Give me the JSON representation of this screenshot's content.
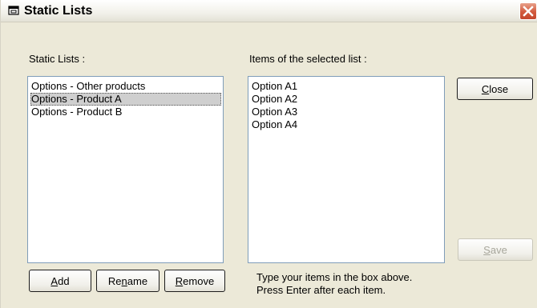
{
  "window": {
    "title": "Static Lists",
    "close_glyph": "✕"
  },
  "left_panel": {
    "label": "Static Lists :",
    "items": [
      {
        "label": "Options - Other products",
        "selected": false
      },
      {
        "label": "Options - Product A",
        "selected": true
      },
      {
        "label": "Options - Product B",
        "selected": false
      }
    ]
  },
  "right_panel": {
    "label": "Items of the selected list :",
    "items": [
      "Option A1",
      "Option A2",
      "Option A3",
      "Option A4"
    ],
    "hint_line1": "Type your items in the box above.",
    "hint_line2": "Press Enter after each item."
  },
  "buttons": {
    "add": {
      "pre": "",
      "mnemonic": "A",
      "post": "dd"
    },
    "rename": {
      "pre": "Re",
      "mnemonic": "n",
      "post": "ame"
    },
    "remove": {
      "pre": "",
      "mnemonic": "R",
      "post": "emove"
    },
    "close": {
      "pre": "",
      "mnemonic": "C",
      "post": "lose"
    },
    "save": {
      "pre": "",
      "mnemonic": "S",
      "post": "ave",
      "enabled": false
    }
  },
  "icons": {
    "title": "window-app-icon",
    "close": "close-icon"
  },
  "colors": {
    "dialog_bg": "#ece9d8",
    "close_button": "#d2593c",
    "selection": "#cfcfcf",
    "list_border": "#7f9db9"
  }
}
